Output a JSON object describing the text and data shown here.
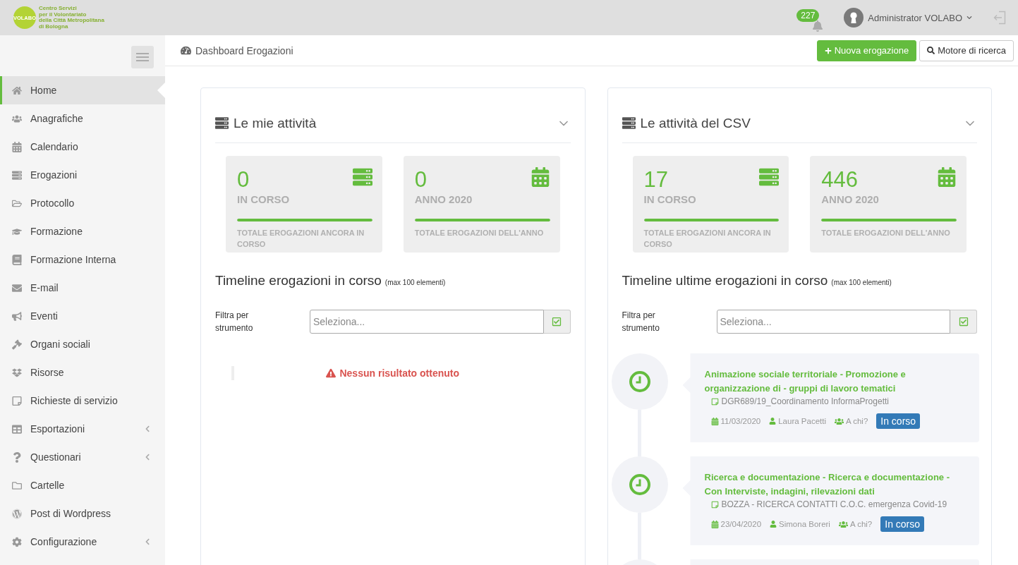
{
  "header": {
    "logo": {
      "mark": "VOLABO",
      "tagline": [
        "Centro Servizi",
        "per il Volontariato",
        "della Città Metropolitana",
        "di Bologna"
      ]
    },
    "notifications": {
      "count": "227"
    },
    "user": {
      "name": "Administrator VOLABO"
    }
  },
  "sidebar": {
    "items": [
      {
        "label": "Home",
        "kind": "link",
        "selected": true
      },
      {
        "label": "Anagrafiche",
        "kind": "link",
        "selected": false
      },
      {
        "label": "Calendario",
        "kind": "link",
        "selected": false
      },
      {
        "label": "Erogazioni",
        "kind": "link",
        "selected": false
      },
      {
        "label": "Protocollo",
        "kind": "link",
        "selected": false
      },
      {
        "label": "Formazione",
        "kind": "link",
        "selected": false
      },
      {
        "label": "Formazione Interna",
        "kind": "link",
        "selected": false
      },
      {
        "label": "E-mail",
        "kind": "link",
        "selected": false
      },
      {
        "label": "Eventi",
        "kind": "link",
        "selected": false
      },
      {
        "label": "Organi sociali",
        "kind": "link",
        "selected": false
      },
      {
        "label": "Risorse",
        "kind": "link",
        "selected": false
      },
      {
        "label": "Richieste di servizio",
        "kind": "link",
        "selected": false
      },
      {
        "label": "Esportazioni",
        "kind": "submenu",
        "selected": false
      },
      {
        "label": "Questionari",
        "kind": "submenu",
        "selected": false
      },
      {
        "label": "Cartelle",
        "kind": "link",
        "selected": false
      },
      {
        "label": "Post di Wordpress",
        "kind": "link",
        "selected": false
      },
      {
        "label": "Configurazione",
        "kind": "submenu",
        "selected": false
      }
    ]
  },
  "toolbar": {
    "title": "Dashboard Erogazioni",
    "actions": [
      {
        "label": "Nuova erogazione",
        "kind": "primary"
      },
      {
        "label": "Motore di ricerca",
        "kind": "default"
      }
    ]
  },
  "panels": [
    {
      "title": "Le mie attività",
      "stats": [
        {
          "kind": "list",
          "value": "0",
          "label": "IN CORSO",
          "level": 1,
          "caption": "TOTALE EROGAZIONI ANCORA IN CORSO"
        },
        {
          "kind": "calendar",
          "value": "0",
          "label": "ANNO 2020",
          "level": 1,
          "caption": "TOTALE EROGAZIONI DELL'ANNO"
        }
      ],
      "timeline": {
        "heading": "Timeline erogazioni in corso",
        "note": "(max 100 elementi)",
        "filter": {
          "label": "Filtra per strumento",
          "placeholder": "Seleziona..."
        },
        "empty_message": "Nessun risultato ottenuto"
      }
    },
    {
      "title": "Le attività del CSV",
      "stats": [
        {
          "kind": "list",
          "value": "17",
          "label": "IN CORSO",
          "level": 1,
          "caption": "TOTALE EROGAZIONI ANCORA IN CORSO"
        },
        {
          "kind": "calendar",
          "value": "446",
          "label": "ANNO 2020",
          "level": 1,
          "caption": "TOTALE EROGAZIONI DELL'ANNO"
        }
      ],
      "timeline": {
        "heading": "Timeline ultime erogazioni in corso",
        "note": "(max 100 elementi)",
        "filter": {
          "label": "Filtra per strumento",
          "placeholder": "Seleziona..."
        },
        "items": [
          {
            "kind": "entry",
            "title": "Animazione sociale territoriale - Promozione e organizzazione di - gruppi di lavoro tematici",
            "subtitle": "DGR689/19_Coordinamento InformaProgetti",
            "date": "11/03/2020",
            "person": "Laura Pacetti",
            "recipients": "A chi?",
            "status": "In corso"
          },
          {
            "kind": "entry",
            "title": "Ricerca e documentazione - Ricerca e documentazione - Con Interviste, indagini, rilevazioni dati",
            "subtitle": "BOZZA - RICERCA CONTATTI C.O.C. emergenza Covid-19",
            "date": "23/04/2020",
            "person": "Simona Boreri",
            "recipients": "A chi?",
            "status": "In corso"
          },
          {
            "kind": "clipped"
          }
        ]
      }
    }
  ]
}
